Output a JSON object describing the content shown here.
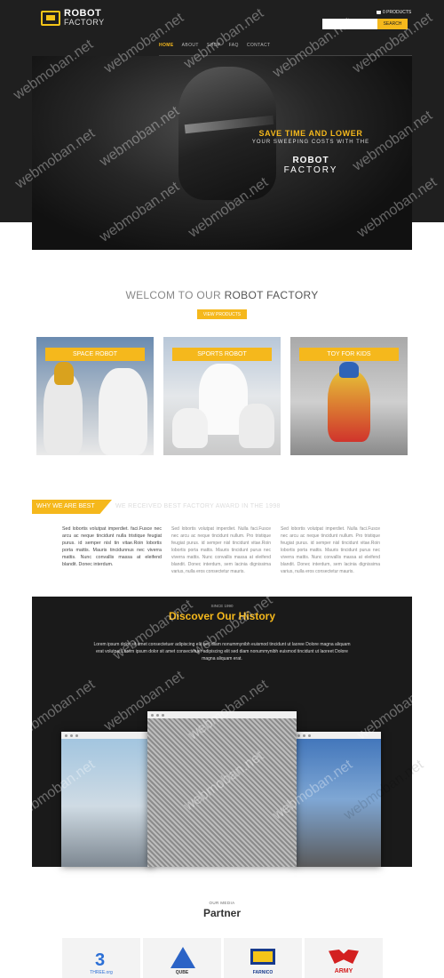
{
  "header": {
    "logo_line1": "ROBOT",
    "logo_line2": "FACTORY",
    "cart": "0 PRODUCTS",
    "search_placeholder": "",
    "search_button": "SEARCH"
  },
  "nav": {
    "items": [
      "HOME",
      "ABOUT",
      "SHOP",
      "FAQ",
      "CONTACT"
    ]
  },
  "hero": {
    "line1": "SAVE TIME AND LOWER",
    "line2": "YOUR SWEEPING COSTS WITH THE",
    "line3": "ROBOT",
    "line4": "FACTORY"
  },
  "welcome": {
    "prefix": "WELCOM TO OUR ",
    "highlight": "ROBOT FACTORY",
    "button": "VIEW PRODUCTS"
  },
  "cards": [
    {
      "label": "SPACE ROBOT"
    },
    {
      "label": "SPORTS ROBOT"
    },
    {
      "label": "TOY FOR KIDS"
    }
  ],
  "why": {
    "tag": "WHY WE ARE BEST",
    "title": "WE RECEIVED BEST FACTORY AWARD IN THE 1998",
    "col1": "Sed lobortis volutpat imperdiet. faci.Fusce nec arcu ac neque tincidunt nulla tristique feugiat purus. id semper nisl tin vitae.Roin lobortis porta mattis. Mauris tincidunnus nec viverra mattis. Nunc convallis massa at eleifend blandit. Donec interdum.",
    "col2": "Sed lobortis volutpat imperdiet. Nulla faci.Fusce nec arcu ac neque tincidunt nullum. Pro tristique feugiat purus. id semper nisl tincidunt vitae.Roin lobortis porta mattis. Mauris tincidunt purus nec viverra mattis. Nunc convallis massa at eleifend blandit. Donec interdum, sem lacinia dignissima varius, nulla eros consectetur mauris.",
    "col3": "Sed lobortis volutpat imperdiet. Nulla faci.Fusce nec arcu ac neque tincidunt nullum. Pro tristique feugiat purus. id semper nisl tincidunt vitae.Roin lobortis porta mattis. Mauris tincidunt purus nec viverra mattis. Nunc convallis massa at eleifend blandit. Donec interdum, sem lacinia dignissima varius, nulla eros consectetur mauris."
  },
  "history": {
    "kicker": "SINCE 1990",
    "title": "Discover Our History",
    "body": "Lorem ipsum dolor sit amet consectetuer adipiscing elit sed diam nonummynibh euismod tincidunt ut laoree Dolore magna aliquam erat volutpat.Lorem ipsum dolor sit amet consectetuer adipiscing elit sed diam nonummynibh euismod tincidunt ut laoreet Dolore magna aliquam erat."
  },
  "partner": {
    "kicker": "OUR MEDIA",
    "title": "Partner",
    "logos": [
      "THREE.org",
      "QUBE",
      "FARNICO",
      "ARMY"
    ]
  },
  "watermark": "webmoban.net",
  "colors": {
    "accent": "#f5b81c",
    "dark": "#1f1f1f"
  }
}
